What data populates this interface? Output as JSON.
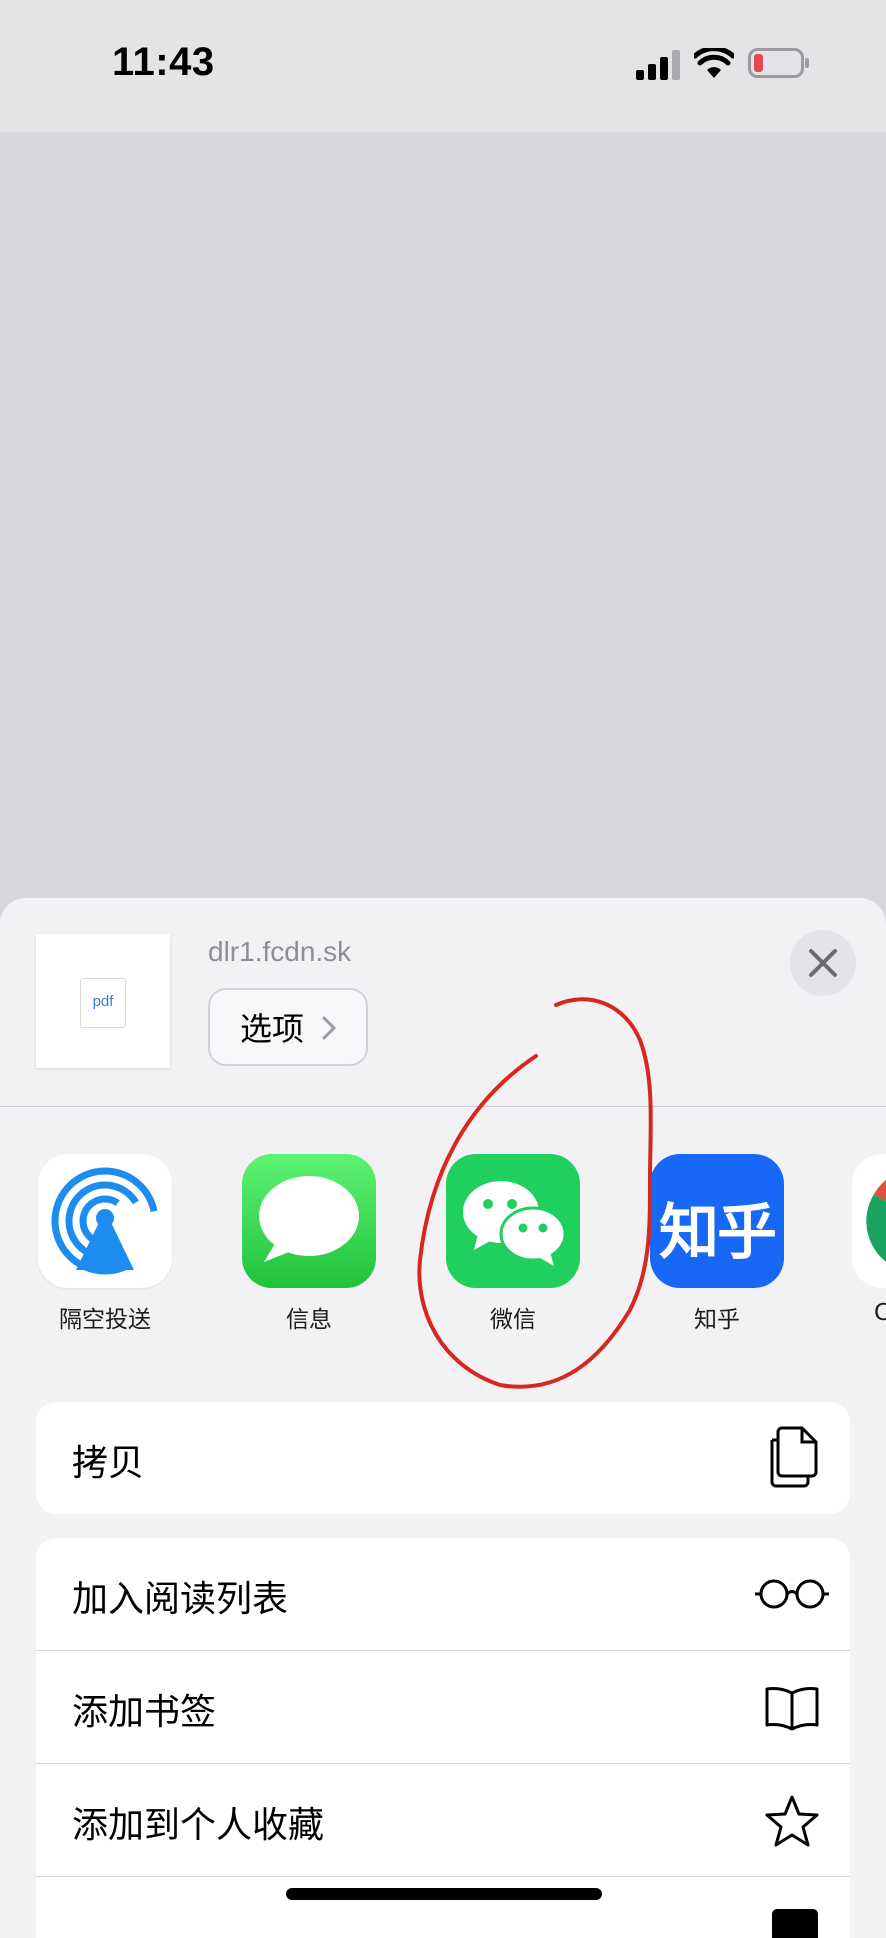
{
  "status_bar": {
    "time": "11:43",
    "battery_color": "#e5484d"
  },
  "share_sheet": {
    "file_type": "pdf",
    "domain": "dlr1.fcdn.sk",
    "options_label": "选项",
    "apps": [
      {
        "label": "隔空投送",
        "icon": "airdrop-icon"
      },
      {
        "label": "信息",
        "icon": "messages-icon"
      },
      {
        "label": "微信",
        "icon": "wechat-icon"
      },
      {
        "label": "知乎",
        "icon": "zhihu-icon",
        "icon_text": "知乎"
      },
      {
        "label": "C",
        "icon": "chrome-icon"
      }
    ],
    "actions_group1": [
      {
        "label": "拷贝",
        "icon": "copy-icon"
      }
    ],
    "actions_group2": [
      {
        "label": "加入阅读列表",
        "icon": "glasses-icon"
      },
      {
        "label": "添加书签",
        "icon": "book-icon"
      },
      {
        "label": "添加到个人收藏",
        "icon": "star-icon"
      }
    ]
  },
  "colors": {
    "wechat_green": "#1fd05f",
    "zhihu_blue": "#1769f5",
    "annotation_red": "#d6281c"
  }
}
